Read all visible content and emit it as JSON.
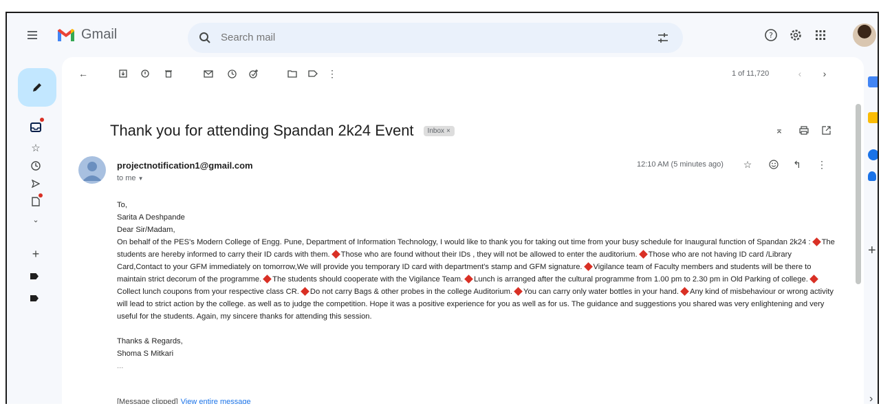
{
  "header": {
    "app_name": "Gmail",
    "search_placeholder": "Search mail"
  },
  "toolbar": {
    "pager": "1 of 11,720"
  },
  "email": {
    "subject": "Thank you for attending Spandan 2k24 Event",
    "label": "Inbox",
    "label_close": "×",
    "sender": "projectnotification1@gmail.com",
    "to": "to me",
    "time": "12:10 AM (5 minutes ago)",
    "salutation": "To,",
    "recipient_name": "Sarita A Deshpande",
    "greeting": "Dear Sir/Madam,",
    "intro": "On behalf of the PES's Modern College of Engg. Pune, Department of Information Technology, I would like to thank you for taking out time from your busy schedule for Inaugural function of Spandan 2k24 :",
    "bullets": [
      "The students are hereby informed to carry their ID cards with them.",
      "Those who are found without their IDs , they will not be allowed to enter the auditorium.",
      "Those who are not having ID card /Library Card,Contact to your GFM immediately on tomorrow,We will provide you temporary ID card with department's stamp and GFM signature.",
      "Vigilance team of Faculty members and students will be there to maintain strict decorum of the programme.",
      "The students should cooperate with the Vigilance Team.",
      "Lunch is arranged after the cultural programme from 1.00 pm to 2.30 pm in Old Parking of college.",
      "Collect lunch coupons from your respective class CR.",
      "Do not carry Bags & other probes in the college Auditorium.",
      "You can carry only water bottles in your hand.",
      "Any kind of misbehaviour or wrong activity will lead to strict action by the college."
    ],
    "closing_para": "as well as to judge the competition. Hope it was a positive experience for you as well as for us. The guidance and suggestions you shared was very enlightening and very useful for the students. Again, my sincere thanks for attending this session.",
    "signoff": "Thanks & Regards,",
    "signature_name": "Shoma S Mitkari",
    "ellipsis": "...",
    "clipped_text": "[Message clipped]",
    "view_entire": "View entire message"
  },
  "colors": {
    "accent": "#1a73e8",
    "compose_bg": "#c2e7ff",
    "bullet": "#d93025",
    "search_bg": "#eaf1fb"
  }
}
